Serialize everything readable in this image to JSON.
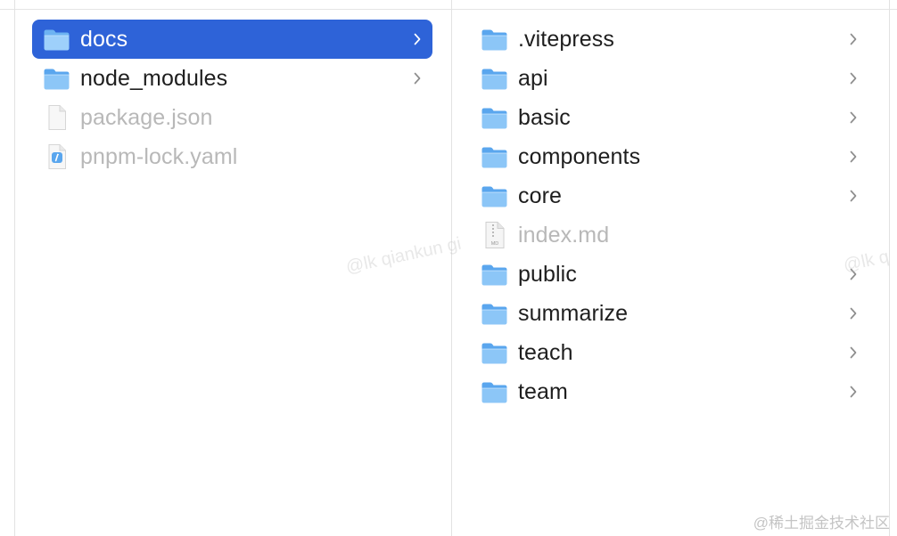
{
  "columns": {
    "left": {
      "items": [
        {
          "name": "docs",
          "kind": "folder",
          "selected": true,
          "has_children": true
        },
        {
          "name": "node_modules",
          "kind": "folder",
          "selected": false,
          "has_children": true
        },
        {
          "name": "package.json",
          "kind": "file",
          "selected": false,
          "has_children": false
        },
        {
          "name": "pnpm-lock.yaml",
          "kind": "yaml-file",
          "selected": false,
          "has_children": false
        }
      ]
    },
    "right": {
      "items": [
        {
          "name": ".vitepress",
          "kind": "folder",
          "has_children": true
        },
        {
          "name": "api",
          "kind": "folder",
          "has_children": true
        },
        {
          "name": "basic",
          "kind": "folder",
          "has_children": true
        },
        {
          "name": "components",
          "kind": "folder",
          "has_children": true
        },
        {
          "name": "core",
          "kind": "folder",
          "has_children": true
        },
        {
          "name": "index.md",
          "kind": "md-file",
          "md_badge": "MD",
          "has_children": false
        },
        {
          "name": "public",
          "kind": "folder",
          "has_children": true
        },
        {
          "name": "summarize",
          "kind": "folder",
          "has_children": true
        },
        {
          "name": "teach",
          "kind": "folder",
          "has_children": true
        },
        {
          "name": "team",
          "kind": "folder",
          "has_children": true
        }
      ]
    }
  },
  "watermark": {
    "text_center": "@lk qiankun gi",
    "text_right": "@lk q",
    "credit": "@稀土掘金技术社区"
  },
  "colors": {
    "selection": "#2e63d8",
    "folder_body": "#8cc6f7",
    "folder_tab": "#5aa6ee",
    "label": "#1e1e1e",
    "dim_label": "#b8b8b8"
  }
}
